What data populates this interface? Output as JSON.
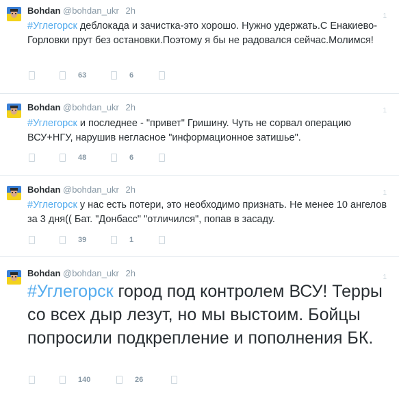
{
  "colors": {
    "hashtag": "#55acee",
    "name": "#292f33",
    "meta": "#8899a6",
    "separator": "#e1e8ed"
  },
  "tweets": [
    {
      "author": "Bohdan",
      "handle": "@bohdan_ukr",
      "time": "2h",
      "counter": "1",
      "hashtag": "#Углегорск",
      "text": " деблокада и зачистка-это хорошо. Нужно удержать.С Енакиево-Горловки прут без остановки.Поэтому я бы не радовался сейчас.Молимся!",
      "retweets": "63",
      "favorites": "6"
    },
    {
      "author": "Bohdan",
      "handle": "@bohdan_ukr",
      "time": "2h",
      "counter": "1",
      "hashtag": "#Углегорск",
      "text": " и последнее - \"привет\" Гришину. Чуть не сорвал операцию ВСУ+НГУ, нарушив негласное \"информационное затишье\".",
      "retweets": "48",
      "favorites": "6"
    },
    {
      "author": "Bohdan",
      "handle": "@bohdan_ukr",
      "time": "2h",
      "counter": "1",
      "hashtag": "#Углегорск",
      "text": " у нас есть потери, это необходимо признать. Не менее 10 ангелов за 3 дня(( Бат. \"Донбасс\" \"отличился\", попав в засаду.",
      "retweets": "39",
      "favorites": "1"
    },
    {
      "author": "Bohdan",
      "handle": "@bohdan_ukr",
      "time": "2h",
      "counter": "1",
      "hashtag": "#Углегорск",
      "text": " город под контролем ВСУ! Терры со всех дыр лезут, но мы выстоим. Бойцы попросили подкрепление и пополнения БК.",
      "retweets": "140",
      "favorites": "26"
    }
  ]
}
